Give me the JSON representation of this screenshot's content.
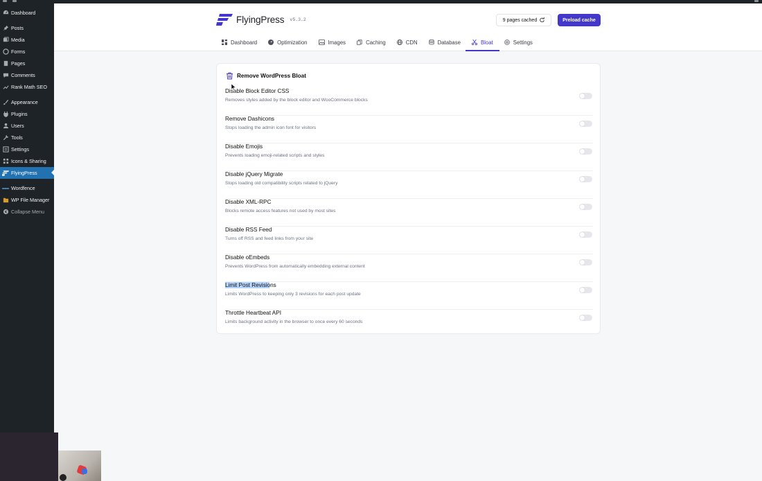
{
  "sidebar": {
    "items": [
      {
        "label": "Dashboard",
        "icon": "dashboard-icon"
      },
      {
        "label": "Posts",
        "icon": "pin-icon"
      },
      {
        "label": "Media",
        "icon": "media-icon"
      },
      {
        "label": "Forms",
        "icon": "forms-icon"
      },
      {
        "label": "Pages",
        "icon": "pages-icon"
      },
      {
        "label": "Comments",
        "icon": "comments-icon"
      },
      {
        "label": "Rank Math SEO",
        "icon": "rankmath-icon"
      },
      {
        "label": "Appearance",
        "icon": "brush-icon"
      },
      {
        "label": "Plugins",
        "icon": "plugin-icon"
      },
      {
        "label": "Users",
        "icon": "users-icon"
      },
      {
        "label": "Tools",
        "icon": "wrench-icon"
      },
      {
        "label": "Settings",
        "icon": "settings-icon"
      },
      {
        "label": "Icons & Sharing",
        "icon": "grid-icon"
      },
      {
        "label": "FlyingPress",
        "icon": "flyingpress-icon"
      },
      {
        "label": "Wordfence",
        "icon": "wordfence-icon"
      },
      {
        "label": "WP File Manager",
        "icon": "folder-icon"
      },
      {
        "label": "Collapse Menu",
        "icon": "collapse-icon"
      }
    ]
  },
  "header": {
    "brand": "FlyingPress",
    "version": "v5.3.2",
    "cached_label": "9 pages cached",
    "preload_label": "Preload cache",
    "accent_color": "#4338ca"
  },
  "tabs": [
    {
      "label": "Dashboard",
      "icon": "grid-icon",
      "active": false
    },
    {
      "label": "Optimization",
      "icon": "gauge-icon",
      "active": false
    },
    {
      "label": "Images",
      "icon": "image-icon",
      "active": false
    },
    {
      "label": "Caching",
      "icon": "copy-icon",
      "active": false
    },
    {
      "label": "CDN",
      "icon": "globe-icon",
      "active": false
    },
    {
      "label": "Database",
      "icon": "database-icon",
      "active": false
    },
    {
      "label": "Bloat",
      "icon": "scissors-icon",
      "active": true
    },
    {
      "label": "Settings",
      "icon": "gear-icon",
      "active": false
    }
  ],
  "card": {
    "title": "Remove WordPress Bloat",
    "settings": [
      {
        "title": "Disable Block Editor CSS",
        "description": "Removes styles added by the block editor and WooCommerce blocks",
        "enabled": false
      },
      {
        "title": "Remove Dashicons",
        "description": "Stops loading the admin icon font for visitors",
        "enabled": false
      },
      {
        "title": "Disable Emojis",
        "description": "Prevents loading emoji-related scripts and styles",
        "enabled": false
      },
      {
        "title": "Disable jQuery Migrate",
        "description": "Stops loading old compatibility scripts related to jQuery",
        "enabled": false
      },
      {
        "title": "Disable XML-RPC",
        "description": "Blocks remote access features not used by most sites",
        "enabled": false
      },
      {
        "title": "Disable RSS Feed",
        "description": "Turns off RSS and feed links from your site",
        "enabled": false
      },
      {
        "title": "Disable oEmbeds",
        "description": "Prevents WordPress from automatically embedding external content",
        "enabled": false
      },
      {
        "title": "Limit Post Revisions",
        "description": "Limits WordPress to keeping only 3 revisions for each post update",
        "enabled": false
      },
      {
        "title": "Throttle Heartbeat API",
        "description": "Limits background activity in the browser to once every 60 seconds",
        "enabled": false
      }
    ]
  }
}
